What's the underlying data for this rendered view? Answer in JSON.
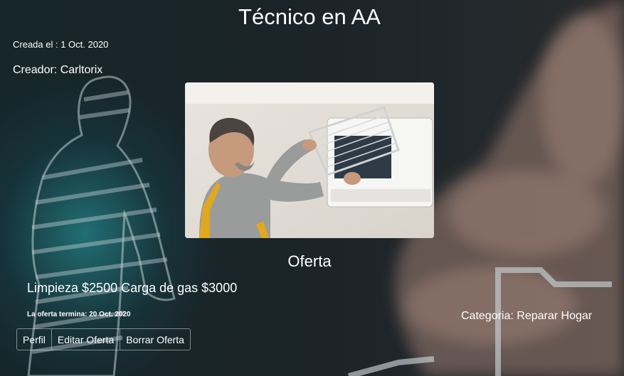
{
  "offer": {
    "title": "Técnico en AA",
    "created": "Creada el : 1 Oct. 2020",
    "creator": "Creador: Carltorix",
    "heading": "Oferta",
    "description": "Limpieza $2500 Carga de gas $3000",
    "ends": "La oferta termina: 20 Oct. 2020",
    "category": "Categoria: Reparar Hogar"
  },
  "actions": {
    "profile": "Perfil",
    "edit": "Editar Oferta",
    "delete": "Borrar Oferta"
  },
  "colors": {
    "text": "#ffffff",
    "accent_glow": "#28aaaf",
    "background": "#1a2328"
  }
}
